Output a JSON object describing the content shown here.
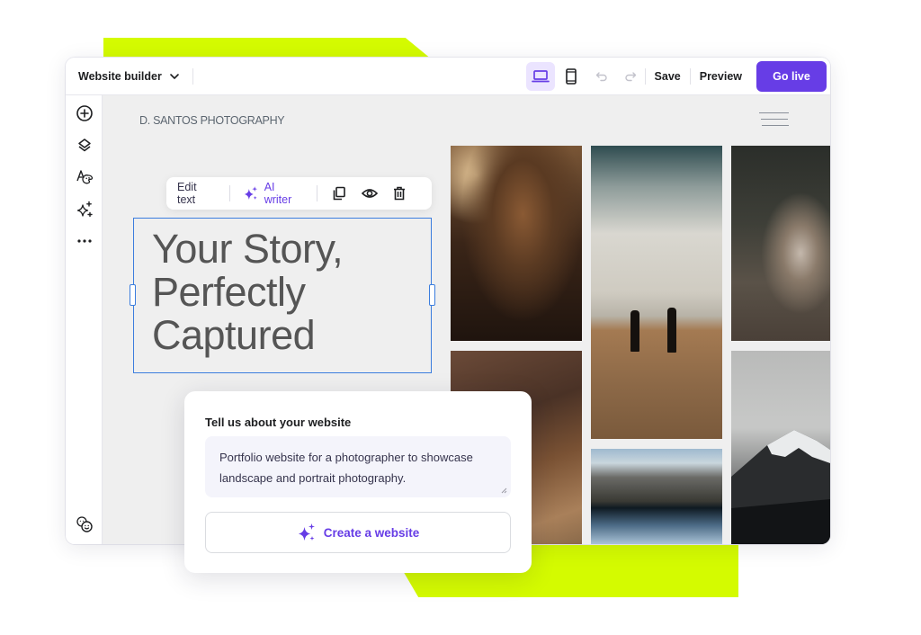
{
  "colors": {
    "accent": "#d4fb00",
    "primary": "#673de6",
    "selection": "#3b7dde"
  },
  "topbar": {
    "builder_label": "Website builder",
    "devices": [
      {
        "icon": "desktop-icon",
        "active": true
      },
      {
        "icon": "mobile-icon",
        "active": false
      }
    ],
    "undo_icon": "undo-icon",
    "redo_icon": "redo-icon",
    "save_label": "Save",
    "preview_label": "Preview",
    "go_live_label": "Go live"
  },
  "sidebar": {
    "items": [
      {
        "icon": "add-icon"
      },
      {
        "icon": "layers-icon"
      },
      {
        "icon": "styles-icon"
      },
      {
        "icon": "ai-sparkles-icon"
      },
      {
        "icon": "more-icon"
      }
    ],
    "bottom_icon": "help-faces-icon"
  },
  "site": {
    "logo": "D. SANTOS PHOTOGRAPHY",
    "heading": "Your Story,\nPerfectly\nCaptured",
    "photos": [
      {
        "subject": "curly-haired woman portrait"
      },
      {
        "subject": "canyon cliffs"
      },
      {
        "subject": "two surfers walking on beach"
      },
      {
        "subject": "mountain lake reflection"
      },
      {
        "subject": "woman crouching in field"
      },
      {
        "subject": "snowy mountain peak"
      }
    ]
  },
  "edit_toolbar": {
    "edit_text_label": "Edit text",
    "ai_writer_label": "AI writer"
  },
  "ai_card": {
    "title": "Tell us about your website",
    "prompt_value": "Portfolio website for a photographer to showcase landscape and portrait photography.",
    "create_label": "Create a website"
  }
}
